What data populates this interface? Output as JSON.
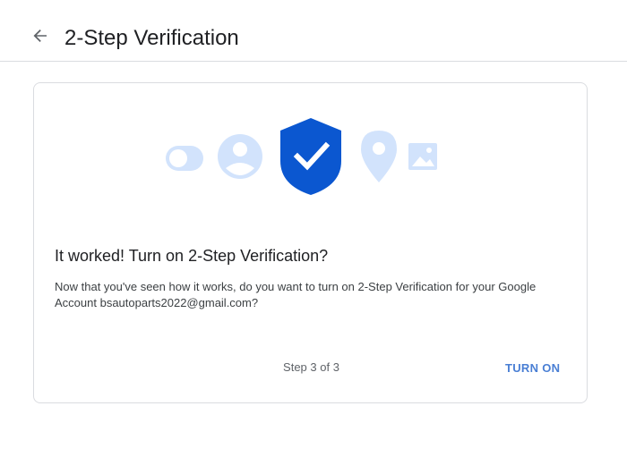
{
  "header": {
    "title": "2-Step Verification",
    "back_icon": "arrow-left-icon"
  },
  "card": {
    "title": "It worked! Turn on 2-Step Verification?",
    "body": "Now that you've seen how it works, do you want to turn on 2-Step Verification for your Google Account bsautoparts2022@gmail.com?",
    "step": "Step 3 of 3",
    "action_label": "TURN ON",
    "illustration_icons": [
      "toggle-icon",
      "account-icon",
      "shield-check-icon",
      "location-pin-icon",
      "image-icon"
    ]
  },
  "colors": {
    "accent": "#1a73e8",
    "shield": "#0b57d0",
    "light_icon": "#d2e3fc",
    "action_text": "#4a7fd4"
  }
}
